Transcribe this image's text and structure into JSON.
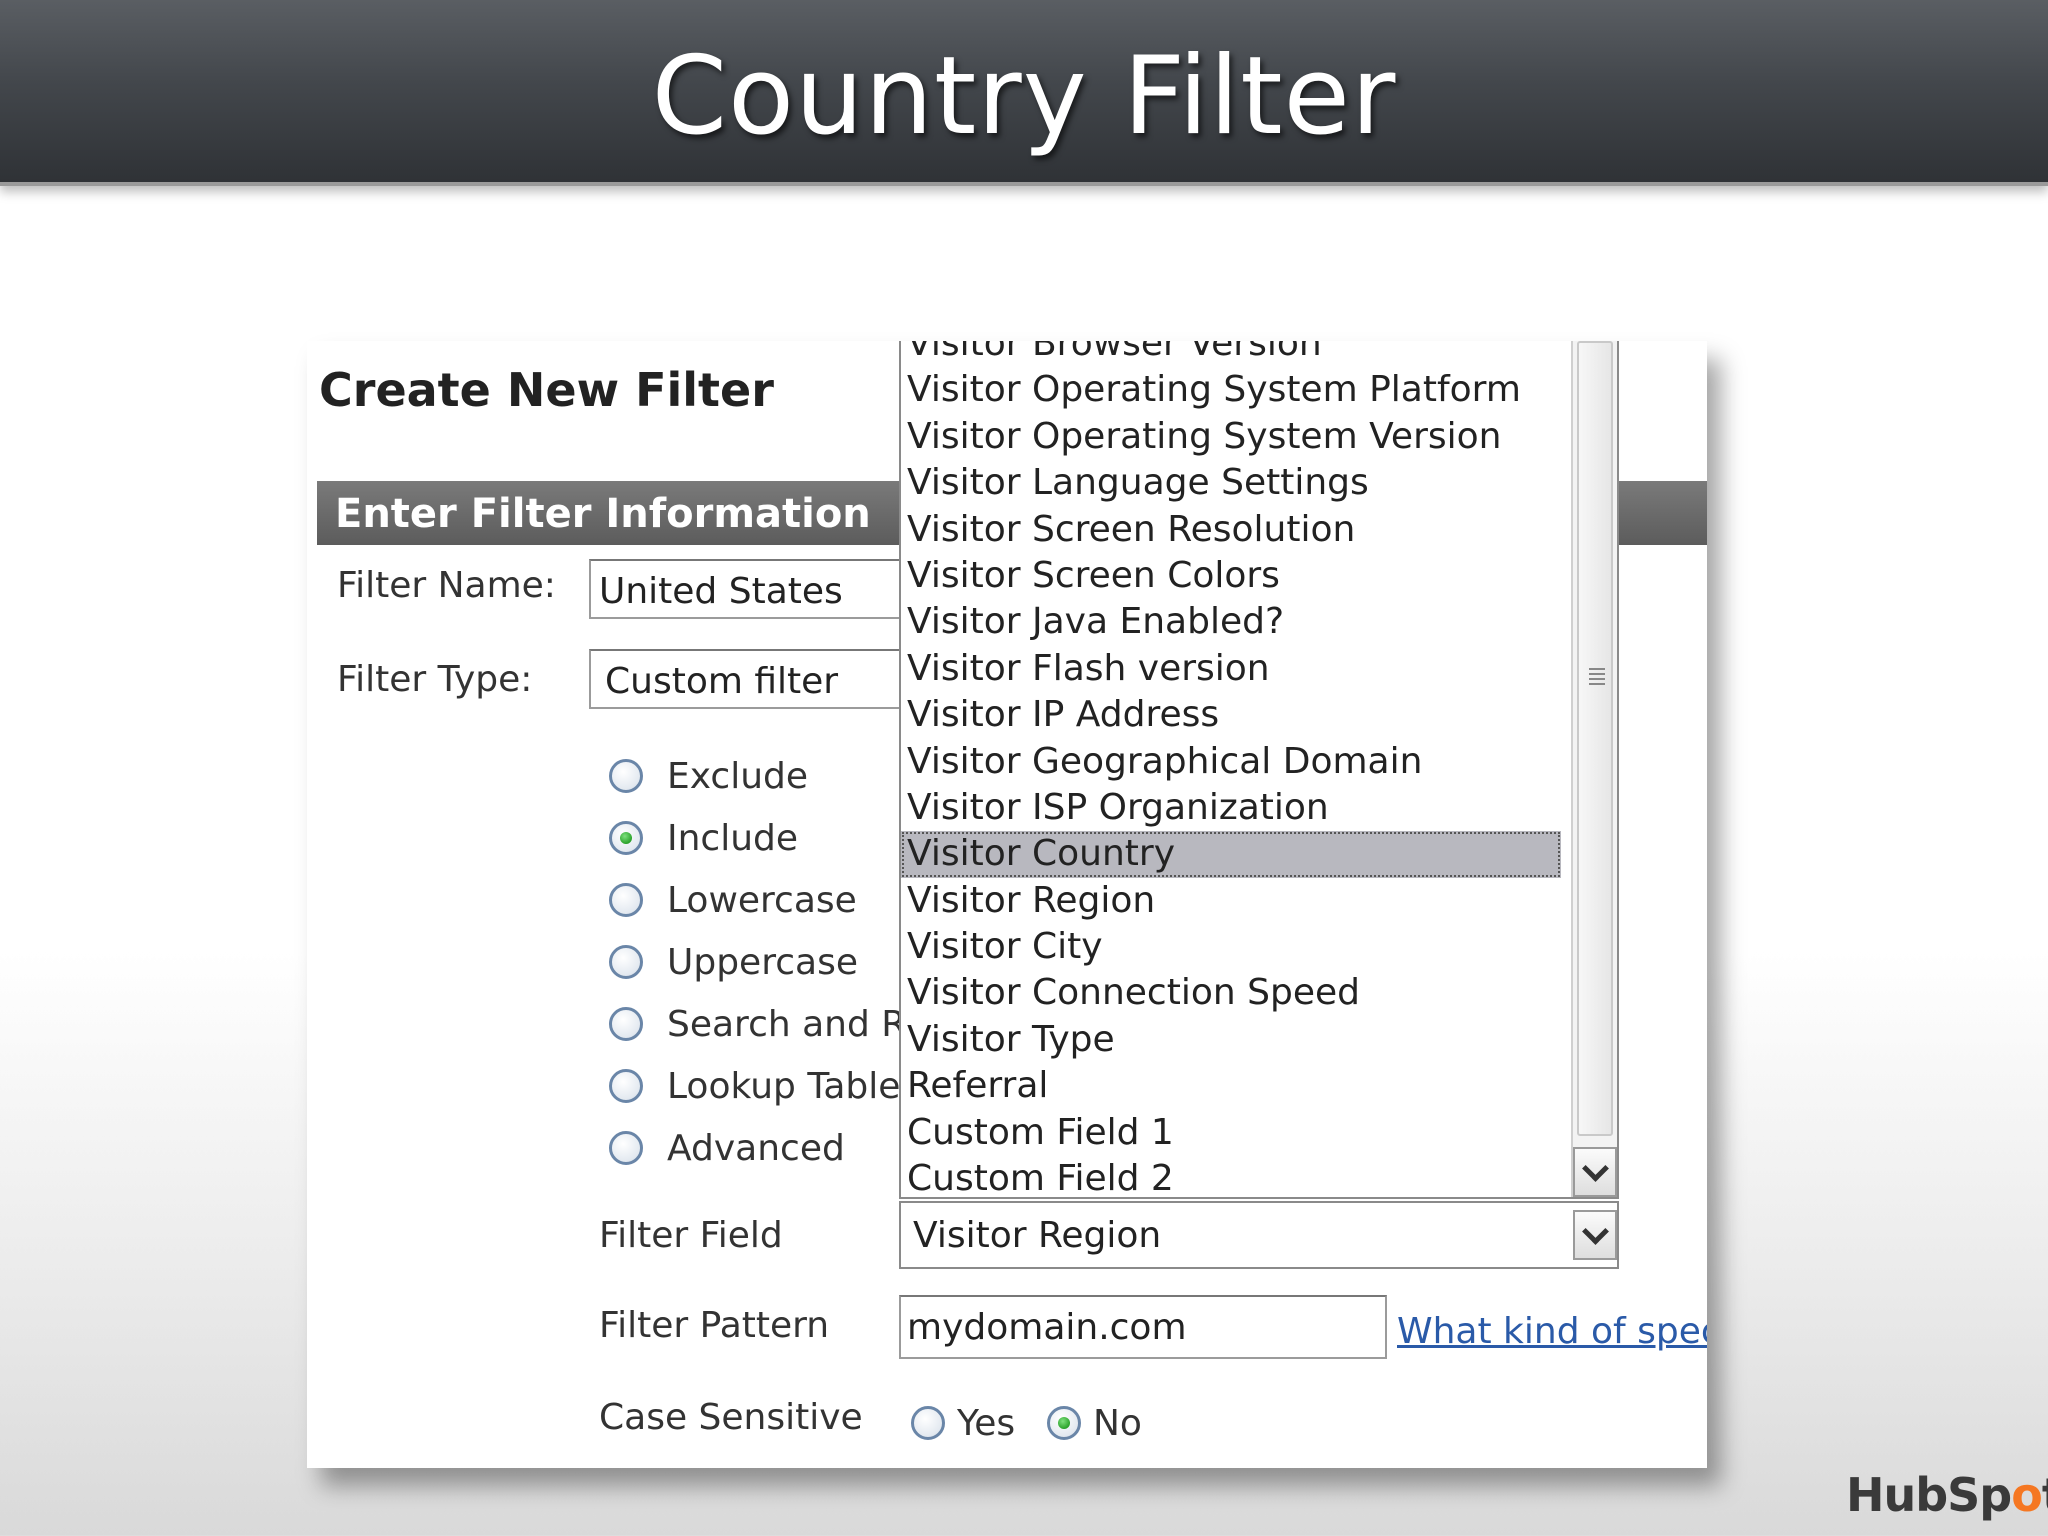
{
  "slide": {
    "title": "Country Filter"
  },
  "form": {
    "title": "Create New Filter",
    "section": "Enter Filter Information",
    "filter_name_label": "Filter Name:",
    "filter_name_value": "United States",
    "filter_type_label": "Filter Type:",
    "filter_type_value": "Custom filter",
    "options": [
      {
        "label": "Exclude",
        "selected": false
      },
      {
        "label": "Include",
        "selected": true
      },
      {
        "label": "Lowercase",
        "selected": false
      },
      {
        "label": "Uppercase",
        "selected": false
      },
      {
        "label": "Search and R",
        "selected": false
      },
      {
        "label": "Lookup Table",
        "selected": false
      },
      {
        "label": "Advanced",
        "selected": false
      }
    ],
    "filter_field_label": "Filter Field",
    "filter_field_value": "Visitor Region",
    "filter_pattern_label": "Filter Pattern",
    "filter_pattern_value": "mydomain.com",
    "help_link": "What kind of speci",
    "case_sensitive_label": "Case Sensitive",
    "case_yes": "Yes",
    "case_no": "No",
    "case_selected": "No"
  },
  "dropdown": {
    "items": [
      "Visitor Browser Version",
      "Visitor Operating System Platform",
      "Visitor Operating System Version",
      "Visitor Language Settings",
      "Visitor Screen Resolution",
      "Visitor Screen Colors",
      "Visitor Java Enabled?",
      "Visitor Flash version",
      "Visitor IP Address",
      "Visitor Geographical Domain",
      "Visitor ISP Organization",
      "Visitor Country",
      "Visitor Region",
      "Visitor City",
      "Visitor Connection Speed",
      "Visitor Type",
      "Referral",
      "Custom Field 1",
      "Custom Field 2"
    ],
    "selected": "Visitor Country"
  },
  "logo": {
    "text_a": "HubSp",
    "text_b": "o",
    "text_c": "t"
  }
}
